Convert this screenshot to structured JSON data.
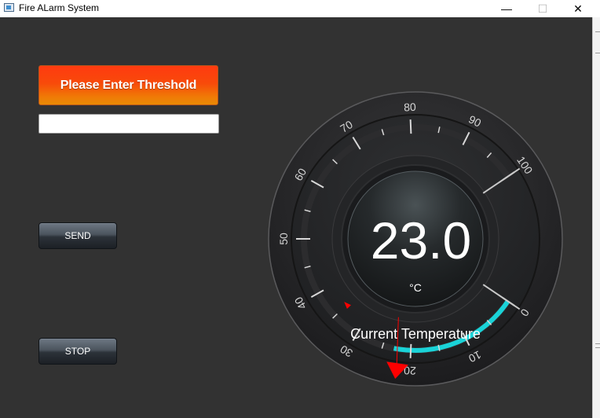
{
  "window": {
    "title": "Fire ALarm System",
    "min_glyph": "—",
    "max_glyph": "☐",
    "close_glyph": "✕"
  },
  "threshold": {
    "banner_label": "Please Enter Threshold",
    "input_value": "",
    "input_placeholder": ""
  },
  "buttons": {
    "send_label": "SEND",
    "stop_label": "STOP"
  },
  "gauge": {
    "min": 0,
    "max": 100,
    "major_tick_step": 10,
    "minor_ticks_per_major": 2,
    "tick_labels": [
      "0",
      "10",
      "20",
      "30",
      "40",
      "50",
      "60",
      "70",
      "80",
      "90",
      "100"
    ],
    "value": 23.0,
    "value_text": "23.0",
    "unit": "°C",
    "caption": "Current Temperature",
    "threshold_marker_value": 22,
    "inner_marker_value": 35,
    "colors": {
      "fill": "#1ad3d8",
      "marker": "#ff0000",
      "face": "#2a2b2d",
      "text": "#ffffff"
    }
  }
}
